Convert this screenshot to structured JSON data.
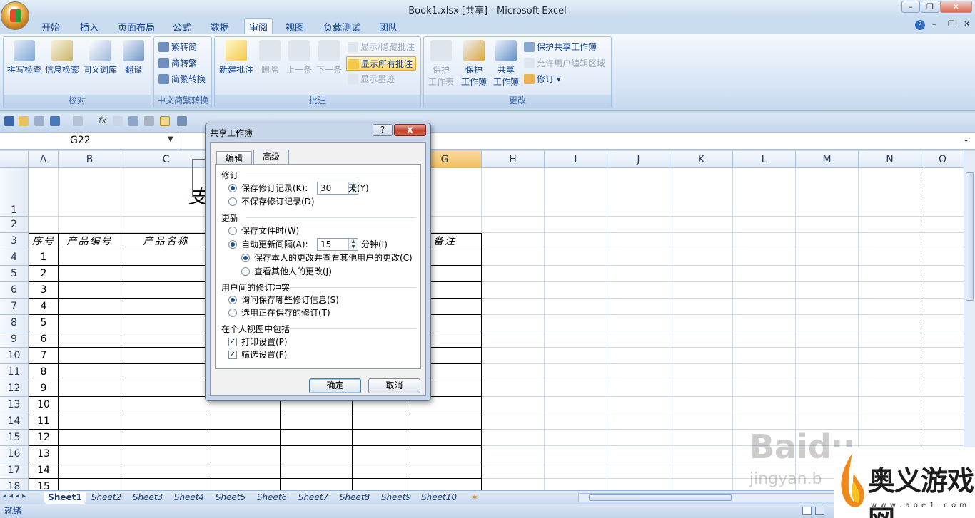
{
  "window": {
    "title": "Book1.xlsx  [共享] - Microsoft Excel"
  },
  "menu": {
    "tabs": [
      "开始",
      "插入",
      "页面布局",
      "公式",
      "数据",
      "审阅",
      "视图",
      "负载测试",
      "团队"
    ],
    "active": "审阅"
  },
  "ribbon": {
    "proofing": {
      "title": "校对",
      "spell": "拼写检查",
      "research": "信息检索",
      "thesaurus": "同义词库",
      "translate": "翻译"
    },
    "chinese": {
      "title": "中文简繁转换",
      "to_simplified": "繁转简",
      "to_traditional": "简转繁",
      "convert": "简繁转换"
    },
    "comments": {
      "title": "批注",
      "new": "新建批注",
      "delete": "删除",
      "prev": "上一条",
      "next": "下一条",
      "show_hide": "显示/隐藏批注",
      "show_all": "显示所有批注",
      "show_ink": "显示墨迹"
    },
    "changes": {
      "title": "更改",
      "protect_sheet_1": "保护",
      "protect_sheet_2": "工作表",
      "protect_book_1": "保护",
      "protect_book_2": "工作簿",
      "share_book_1": "共享",
      "share_book_2": "工作簿",
      "protect_share": "保护共享工作簿",
      "allow_edit": "允许用户编辑区域",
      "track": "修订"
    }
  },
  "formula_bar": {
    "name_box": "G22"
  },
  "grid": {
    "columns": [
      "A",
      "B",
      "C",
      "D",
      "E",
      "F",
      "G",
      "H",
      "I",
      "J",
      "K",
      "L",
      "M",
      "N",
      "O"
    ],
    "rows": [
      "1",
      "2",
      "3",
      "4",
      "5",
      "6",
      "7",
      "8",
      "9",
      "10",
      "11",
      "12",
      "13",
      "14",
      "15",
      "16",
      "17",
      "18"
    ],
    "title_fragment": "支",
    "headers": {
      "seq": "序号",
      "code": "产品编号",
      "name": "产品名称",
      "remark": "备注"
    },
    "seq_values": [
      "1",
      "2",
      "3",
      "4",
      "5",
      "6",
      "7",
      "8",
      "9",
      "10",
      "11",
      "12",
      "13",
      "14",
      "15"
    ]
  },
  "sheets": [
    "Sheet1",
    "Sheet2",
    "Sheet3",
    "Sheet4",
    "Sheet5",
    "Sheet6",
    "Sheet7",
    "Sheet8",
    "Sheet9",
    "Sheet10"
  ],
  "status": {
    "ready": "就绪"
  },
  "dialog": {
    "title": "共享工作簿",
    "help": "?",
    "close": "x",
    "tabs": [
      "编辑",
      "高级"
    ],
    "active_tab": "高级",
    "track_section": "修订",
    "keep_history": "保存修订记录(K):",
    "keep_days": "30",
    "days_unit": "天(Y)",
    "dont_keep": "不保存修订记录(D)",
    "update_section": "更新",
    "when_saved": "保存文件时(W)",
    "auto_every": "自动更新间隔(A):",
    "minutes": "15",
    "minutes_unit": "分钟(I)",
    "save_and_see": "保存本人的更改并查看其他用户的更改(C)",
    "just_see": "查看其他人的更改(J)",
    "conflict_section": "用户间的修订冲突",
    "ask_me": "询问保存哪些修订信息(S)",
    "saved_wins": "选用正在保存的修订(T)",
    "include_section": "在个人视图中包括",
    "print_settings": "打印设置(P)",
    "filter_settings": "筛选设置(F)",
    "ok": "确定",
    "cancel": "取消"
  },
  "watermarks": {
    "baidu": "Baidu",
    "jingyan": "jingyan.b",
    "site_name": "奥义游戏网",
    "site_url": "w w w . a o e 1 . c o m"
  }
}
